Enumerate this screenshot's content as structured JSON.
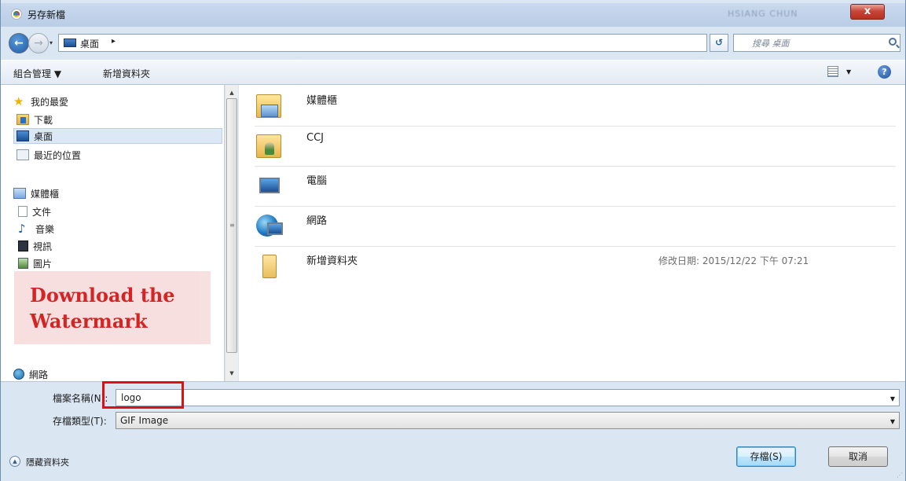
{
  "window": {
    "title": "另存新檔",
    "user_blurred": "HSIANG CHUN",
    "close_label": "x"
  },
  "nav": {
    "back_label": "←",
    "forward_label": "→",
    "address": "桌面",
    "address_sep": "▸",
    "search_placeholder": "搜尋 桌面"
  },
  "toolbar": {
    "organize_label": "組合管理 ▼",
    "new_folder_label": "新增資料夾"
  },
  "sidebar": {
    "favorites": "我的最愛",
    "downloads": "下載",
    "desktop": "桌面",
    "recent": "最近的位置",
    "libraries": "媒體櫃",
    "documents": "文件",
    "music": "音樂",
    "videos": "視訊",
    "pictures": "圖片",
    "network": "網路"
  },
  "files": [
    {
      "name": "媒體櫃",
      "meta": ""
    },
    {
      "name": "CCJ",
      "meta": ""
    },
    {
      "name": "電腦",
      "meta": ""
    },
    {
      "name": "網路",
      "meta": ""
    },
    {
      "name": "新增資料夾",
      "meta": "修改日期: 2015/12/22 下午 07:21"
    }
  ],
  "watermark": "Download the Watermark",
  "form": {
    "filename_label": "檔案名稱(N):",
    "filename_value": "logo",
    "filetype_label": "存檔類型(T):",
    "filetype_value": "GIF Image",
    "hide_folders_label": "隱藏資料夾",
    "save_label": "存檔(S)",
    "cancel_label": "取消"
  }
}
